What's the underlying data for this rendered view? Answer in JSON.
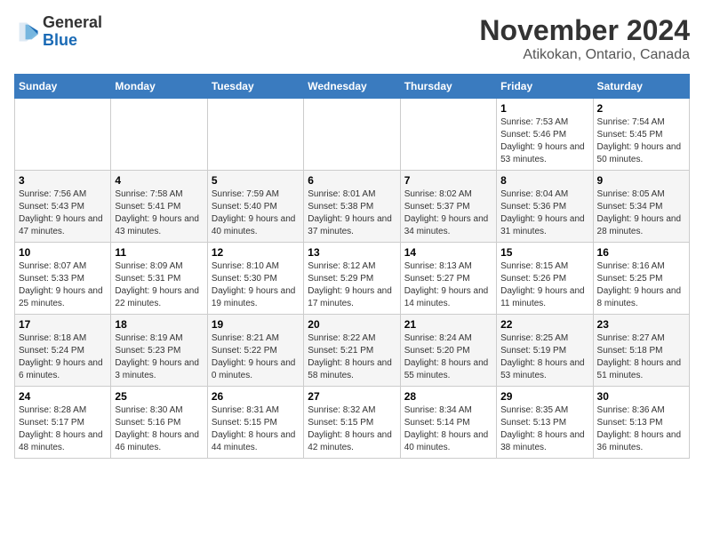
{
  "logo": {
    "general": "General",
    "blue": "Blue"
  },
  "title": "November 2024",
  "location": "Atikokan, Ontario, Canada",
  "days_header": [
    "Sunday",
    "Monday",
    "Tuesday",
    "Wednesday",
    "Thursday",
    "Friday",
    "Saturday"
  ],
  "weeks": [
    [
      {
        "day": "",
        "info": ""
      },
      {
        "day": "",
        "info": ""
      },
      {
        "day": "",
        "info": ""
      },
      {
        "day": "",
        "info": ""
      },
      {
        "day": "",
        "info": ""
      },
      {
        "day": "1",
        "info": "Sunrise: 7:53 AM\nSunset: 5:46 PM\nDaylight: 9 hours and 53 minutes."
      },
      {
        "day": "2",
        "info": "Sunrise: 7:54 AM\nSunset: 5:45 PM\nDaylight: 9 hours and 50 minutes."
      }
    ],
    [
      {
        "day": "3",
        "info": "Sunrise: 7:56 AM\nSunset: 5:43 PM\nDaylight: 9 hours and 47 minutes."
      },
      {
        "day": "4",
        "info": "Sunrise: 7:58 AM\nSunset: 5:41 PM\nDaylight: 9 hours and 43 minutes."
      },
      {
        "day": "5",
        "info": "Sunrise: 7:59 AM\nSunset: 5:40 PM\nDaylight: 9 hours and 40 minutes."
      },
      {
        "day": "6",
        "info": "Sunrise: 8:01 AM\nSunset: 5:38 PM\nDaylight: 9 hours and 37 minutes."
      },
      {
        "day": "7",
        "info": "Sunrise: 8:02 AM\nSunset: 5:37 PM\nDaylight: 9 hours and 34 minutes."
      },
      {
        "day": "8",
        "info": "Sunrise: 8:04 AM\nSunset: 5:36 PM\nDaylight: 9 hours and 31 minutes."
      },
      {
        "day": "9",
        "info": "Sunrise: 8:05 AM\nSunset: 5:34 PM\nDaylight: 9 hours and 28 minutes."
      }
    ],
    [
      {
        "day": "10",
        "info": "Sunrise: 8:07 AM\nSunset: 5:33 PM\nDaylight: 9 hours and 25 minutes."
      },
      {
        "day": "11",
        "info": "Sunrise: 8:09 AM\nSunset: 5:31 PM\nDaylight: 9 hours and 22 minutes."
      },
      {
        "day": "12",
        "info": "Sunrise: 8:10 AM\nSunset: 5:30 PM\nDaylight: 9 hours and 19 minutes."
      },
      {
        "day": "13",
        "info": "Sunrise: 8:12 AM\nSunset: 5:29 PM\nDaylight: 9 hours and 17 minutes."
      },
      {
        "day": "14",
        "info": "Sunrise: 8:13 AM\nSunset: 5:27 PM\nDaylight: 9 hours and 14 minutes."
      },
      {
        "day": "15",
        "info": "Sunrise: 8:15 AM\nSunset: 5:26 PM\nDaylight: 9 hours and 11 minutes."
      },
      {
        "day": "16",
        "info": "Sunrise: 8:16 AM\nSunset: 5:25 PM\nDaylight: 9 hours and 8 minutes."
      }
    ],
    [
      {
        "day": "17",
        "info": "Sunrise: 8:18 AM\nSunset: 5:24 PM\nDaylight: 9 hours and 6 minutes."
      },
      {
        "day": "18",
        "info": "Sunrise: 8:19 AM\nSunset: 5:23 PM\nDaylight: 9 hours and 3 minutes."
      },
      {
        "day": "19",
        "info": "Sunrise: 8:21 AM\nSunset: 5:22 PM\nDaylight: 9 hours and 0 minutes."
      },
      {
        "day": "20",
        "info": "Sunrise: 8:22 AM\nSunset: 5:21 PM\nDaylight: 8 hours and 58 minutes."
      },
      {
        "day": "21",
        "info": "Sunrise: 8:24 AM\nSunset: 5:20 PM\nDaylight: 8 hours and 55 minutes."
      },
      {
        "day": "22",
        "info": "Sunrise: 8:25 AM\nSunset: 5:19 PM\nDaylight: 8 hours and 53 minutes."
      },
      {
        "day": "23",
        "info": "Sunrise: 8:27 AM\nSunset: 5:18 PM\nDaylight: 8 hours and 51 minutes."
      }
    ],
    [
      {
        "day": "24",
        "info": "Sunrise: 8:28 AM\nSunset: 5:17 PM\nDaylight: 8 hours and 48 minutes."
      },
      {
        "day": "25",
        "info": "Sunrise: 8:30 AM\nSunset: 5:16 PM\nDaylight: 8 hours and 46 minutes."
      },
      {
        "day": "26",
        "info": "Sunrise: 8:31 AM\nSunset: 5:15 PM\nDaylight: 8 hours and 44 minutes."
      },
      {
        "day": "27",
        "info": "Sunrise: 8:32 AM\nSunset: 5:15 PM\nDaylight: 8 hours and 42 minutes."
      },
      {
        "day": "28",
        "info": "Sunrise: 8:34 AM\nSunset: 5:14 PM\nDaylight: 8 hours and 40 minutes."
      },
      {
        "day": "29",
        "info": "Sunrise: 8:35 AM\nSunset: 5:13 PM\nDaylight: 8 hours and 38 minutes."
      },
      {
        "day": "30",
        "info": "Sunrise: 8:36 AM\nSunset: 5:13 PM\nDaylight: 8 hours and 36 minutes."
      }
    ]
  ]
}
